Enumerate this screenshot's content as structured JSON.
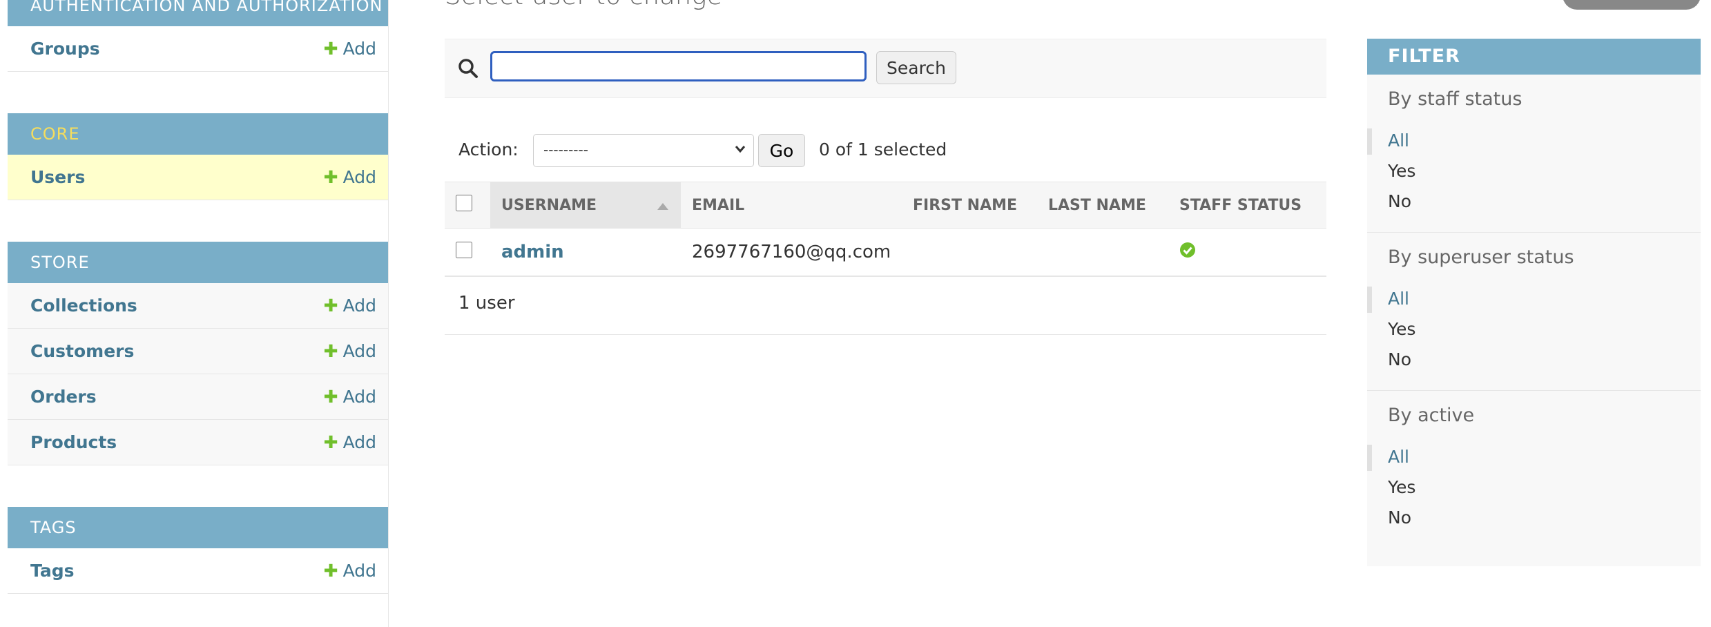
{
  "sidebar": {
    "add_label": "Add",
    "modules": [
      {
        "title": "Authentication and Authorization",
        "models": [
          {
            "name": "Groups"
          }
        ]
      },
      {
        "title": "Core",
        "models": [
          {
            "name": "Users"
          }
        ]
      },
      {
        "title": "Store",
        "models": [
          {
            "name": "Collections"
          },
          {
            "name": "Customers"
          },
          {
            "name": "Orders"
          },
          {
            "name": "Products"
          }
        ]
      },
      {
        "title": "Tags",
        "models": [
          {
            "name": "Tags"
          }
        ]
      }
    ]
  },
  "content": {
    "title": "Select user to change",
    "search": {
      "value": "",
      "button_label": "Search",
      "icon": "search-icon"
    },
    "actions": {
      "label": "Action:",
      "selected_option": "---------",
      "go_label": "Go",
      "counter": "0 of 1 selected"
    },
    "table": {
      "columns": [
        "Username",
        "Email",
        "First name",
        "Last name",
        "Staff status"
      ],
      "sorted_column": "Username",
      "rows": [
        {
          "username": "admin",
          "email": "2697767160@qq.com",
          "first_name": "",
          "last_name": "",
          "staff_status": "check-icon"
        }
      ]
    },
    "paginator": "1 user"
  },
  "filter": {
    "header": "FILTER",
    "groups": [
      {
        "title": "By staff status",
        "options": [
          "All",
          "Yes",
          "No"
        ],
        "selected": "All"
      },
      {
        "title": "By superuser status",
        "options": [
          "All",
          "Yes",
          "No"
        ],
        "selected": "All"
      },
      {
        "title": "By active",
        "options": [
          "All",
          "Yes",
          "No"
        ],
        "selected": "All"
      }
    ]
  },
  "colors": {
    "module_header": "#79aec8",
    "link": "#417690",
    "add_plus": "#70bf2b",
    "selected_row": "#ffffcc",
    "core_header_text": "#f5dd5d",
    "check_green": "#70bf2b"
  }
}
